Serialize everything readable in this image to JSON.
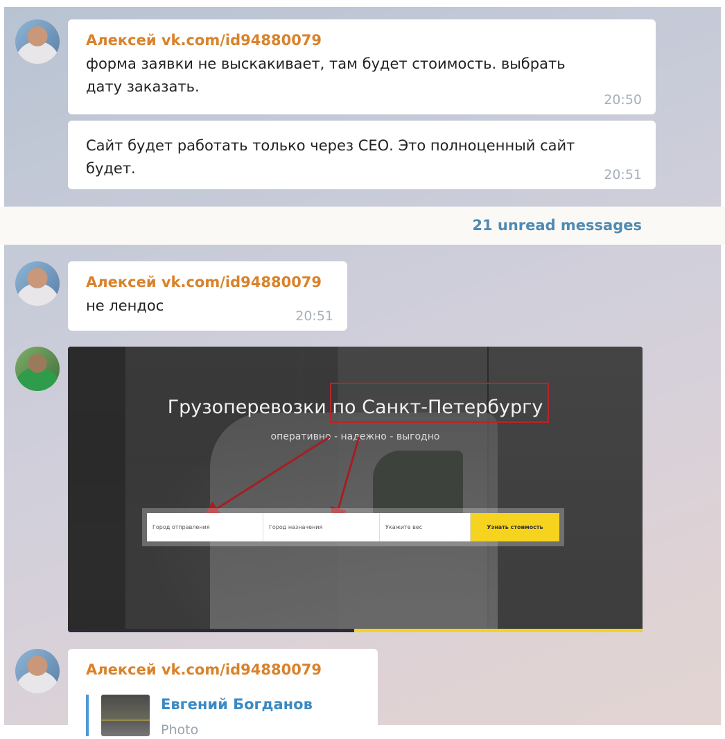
{
  "chat": {
    "messages": [
      {
        "sender": "Алексей vk.com/id94880079",
        "text_lines": [
          "форма заявки не выскакивает, там будет стоимость.  выбрать",
          "дату заказать."
        ],
        "time": "20:50"
      },
      {
        "sender": "",
        "text_lines": [
          "Сайт будет работать только через СЕО. Это полноценный сайт",
          "будет."
        ],
        "time": "20:51"
      }
    ],
    "unread_label": "21 unread messages",
    "after_unread": [
      {
        "sender": "Алексей vk.com/id94880079",
        "text": "не лендос",
        "time": "20:51"
      }
    ],
    "photo": {
      "headline": "Грузоперевозки по Санкт-Петербургу",
      "tagline": "оперативно  -  надежно  -  выгодно",
      "form": {
        "field1": "Город отправления",
        "field2": "Город назначения",
        "field3": "Укажите вес",
        "button": "Узнать стоимость"
      },
      "accent_yellow": "#f2d324",
      "annotation_red": "#b3262a"
    },
    "reply_message": {
      "sender": "Алексей vk.com/id94880079",
      "reply_name": "Евгений Богданов",
      "reply_type": "Photo"
    }
  },
  "colors": {
    "sender_orange": "#d9822b",
    "link_blue": "#4f8ab3",
    "time_gray": "#a6b0b8"
  }
}
